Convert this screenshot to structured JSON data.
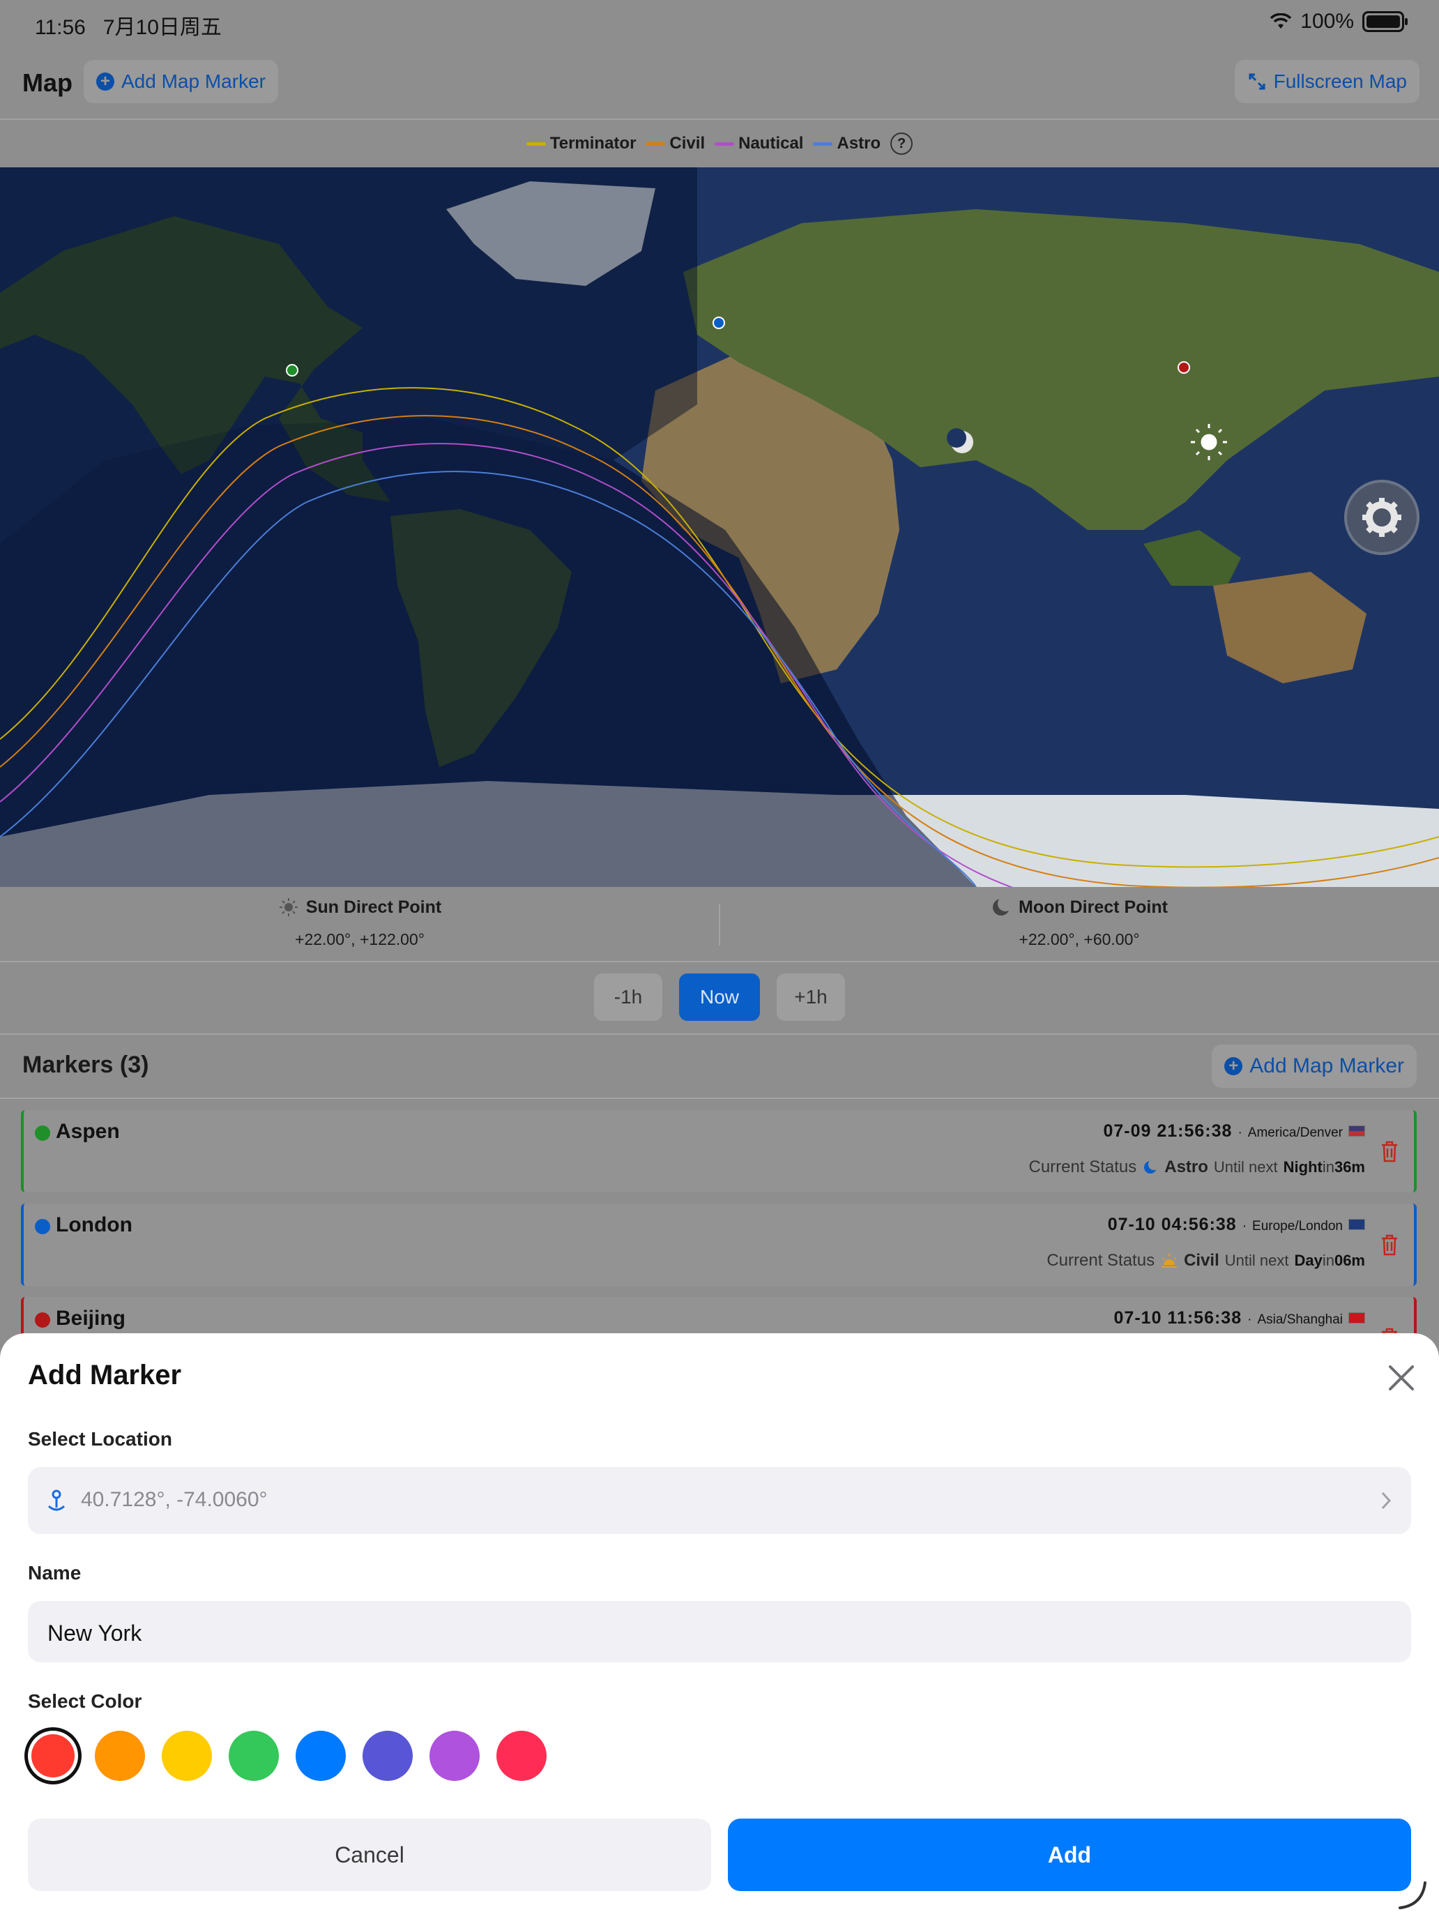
{
  "status_bar": {
    "time": "11:56",
    "date": "7月10日周五",
    "battery": "100%"
  },
  "nav": {
    "title": "Map",
    "add_marker": "Add Map Marker",
    "fullscreen": "Fullscreen Map"
  },
  "legend": {
    "items": [
      {
        "label": "Terminator",
        "color": "#c9b000"
      },
      {
        "label": "Civil",
        "color": "#d47f13"
      },
      {
        "label": "Nautical",
        "color": "#b04ec9"
      },
      {
        "label": "Astro",
        "color": "#4a7ed8"
      }
    ],
    "help_icon": "question-circle-icon"
  },
  "direct_points": {
    "sun": {
      "title": "Sun Direct Point",
      "value": "+22.00°, +122.00°"
    },
    "moon": {
      "title": "Moon Direct Point",
      "value": "+22.00°, +60.00°"
    }
  },
  "time_controls": {
    "minus": "-1h",
    "now": "Now",
    "plus": "+1h"
  },
  "markers": {
    "title": "Markers (3)",
    "add": "Add Map Marker",
    "items": [
      {
        "name": "Aspen",
        "color": "#1f8f2a",
        "datetime": "07-09 21:56:38",
        "tz": "America/Denver",
        "status_label": "Current Status",
        "status": "Astro",
        "until": "Until next",
        "next": "Night",
        "in": "in",
        "remaining": "36m"
      },
      {
        "name": "London",
        "color": "#0a5ec7",
        "datetime": "07-10 04:56:38",
        "tz": "Europe/London",
        "status_label": "Current Status",
        "status": "Civil",
        "until": "Until next",
        "next": "Day",
        "in": "in",
        "remaining": "06m"
      },
      {
        "name": "Beijing",
        "color": "#b31818",
        "datetime": "07-10 11:56:38",
        "tz": "Asia/Shanghai"
      }
    ]
  },
  "sheet": {
    "title": "Add Marker",
    "location_label": "Select Location",
    "location_value": "40.7128°, -74.0060°",
    "name_label": "Name",
    "name_value": "New York",
    "color_label": "Select Color",
    "colors": [
      "#ff3b30",
      "#ff9500",
      "#ffcc00",
      "#34c759",
      "#007aff",
      "#5856d6",
      "#af52de",
      "#ff2d55"
    ],
    "selected_color": "#ff3b30",
    "cancel": "Cancel",
    "add": "Add"
  }
}
